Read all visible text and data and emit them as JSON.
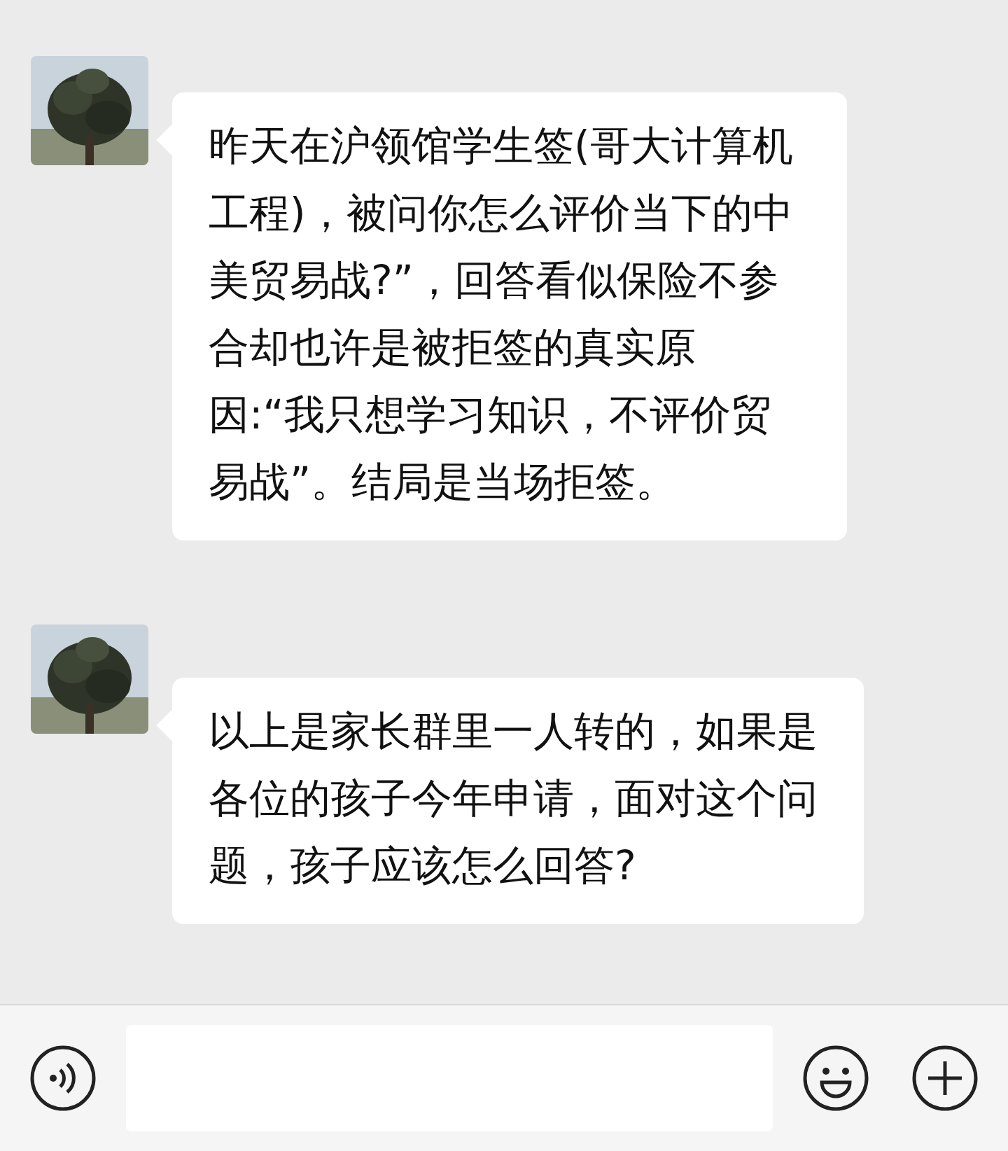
{
  "messages": [
    {
      "text": "昨天在沪领馆学生签(哥大计算机工程)，被问你怎么评价当下的中美贸易战?”，回答看似保险不参合却也许是被拒签的真实原因:“我只想学习知识，不评价贸易战”。结局是当场拒签。"
    },
    {
      "text": "以上是家长群里一人转的，如果是各位的孩子今年申请，面对这个问题，孩子应该怎么回答?"
    }
  ]
}
